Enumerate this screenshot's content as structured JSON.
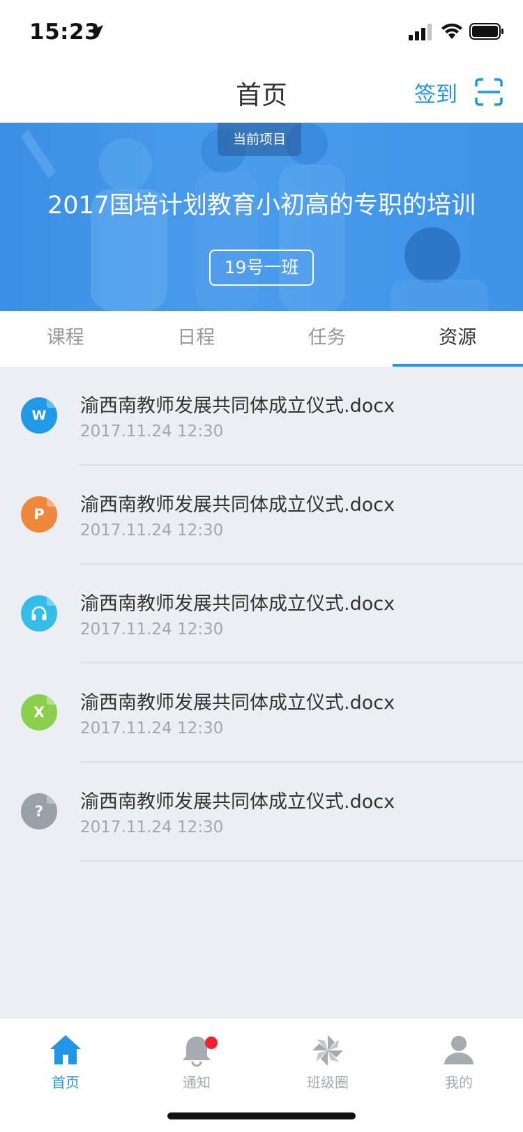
{
  "status_bar": {
    "time": "15:23"
  },
  "nav": {
    "title": "首页",
    "checkin_label": "签到"
  },
  "banner": {
    "tag": "当前项目",
    "title": "2017国培计划教育小初高的专职的培训",
    "class_name": "19号一班"
  },
  "tabs": [
    {
      "label": "课程",
      "active": false
    },
    {
      "label": "日程",
      "active": false
    },
    {
      "label": "任务",
      "active": false
    },
    {
      "label": "资源",
      "active": true
    }
  ],
  "resources": [
    {
      "icon": "word-file-icon",
      "icon_letter": "W",
      "name": "渝西南教师发展共同体成立仪式.docx",
      "date": "2017.11.24 12:30"
    },
    {
      "icon": "ppt-file-icon",
      "icon_letter": "P",
      "name": "渝西南教师发展共同体成立仪式.docx",
      "date": "2017.11.24 12:30"
    },
    {
      "icon": "audio-file-icon",
      "icon_letter": "",
      "name": "渝西南教师发展共同体成立仪式.docx",
      "date": "2017.11.24 12:30"
    },
    {
      "icon": "excel-file-icon",
      "icon_letter": "X",
      "name": "渝西南教师发展共同体成立仪式.docx",
      "date": "2017.11.24 12:30"
    },
    {
      "icon": "unknown-file-icon",
      "icon_letter": "?",
      "name": "渝西南教师发展共同体成立仪式.docx",
      "date": "2017.11.24 12:30"
    }
  ],
  "tab_bar": [
    {
      "label": "首页",
      "icon": "home-icon",
      "active": true
    },
    {
      "label": "通知",
      "icon": "bell-icon",
      "active": false,
      "badge": true
    },
    {
      "label": "班级圈",
      "icon": "pinwheel-icon",
      "active": false
    },
    {
      "label": "我的",
      "icon": "user-icon",
      "active": false
    }
  ],
  "colors": {
    "accent": "#2196e8",
    "badge": "#f5212d",
    "background": "#ebeef2"
  }
}
